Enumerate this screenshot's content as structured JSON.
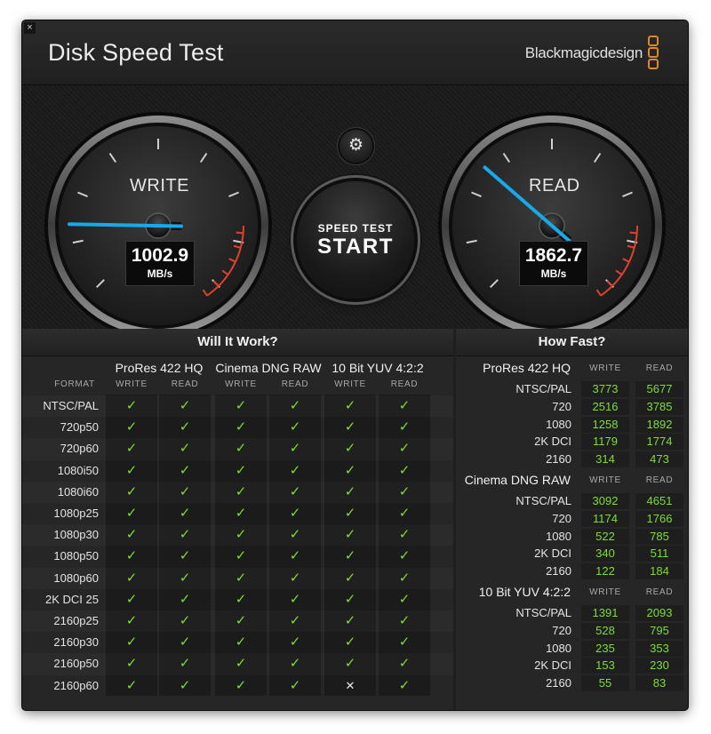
{
  "window": {
    "close_icon": "close-icon",
    "close_glyph": "×",
    "title": "Disk Speed Test",
    "brand": "Blackmagicdesign"
  },
  "gauges": {
    "write": {
      "label": "WRITE",
      "value": "1002.9",
      "unit": "MB/s"
    },
    "read": {
      "label": "READ",
      "value": "1862.7",
      "unit": "MB/s"
    }
  },
  "controls": {
    "settings_icon": "gear-icon",
    "settings_glyph": "⚙",
    "start_small": "SPEED TEST",
    "start_big": "START"
  },
  "will_it_work": {
    "title": "Will It Work?",
    "format_label": "FORMAT",
    "codecs": [
      "ProRes 422 HQ",
      "Cinema DNG RAW",
      "10 Bit YUV 4:2:2"
    ],
    "sub": [
      "WRITE",
      "READ"
    ],
    "check_glyph": "✓",
    "cross_glyph": "✕",
    "rows": [
      {
        "format": "NTSC/PAL",
        "results": [
          true,
          true,
          true,
          true,
          true,
          true
        ]
      },
      {
        "format": "720p50",
        "results": [
          true,
          true,
          true,
          true,
          true,
          true
        ]
      },
      {
        "format": "720p60",
        "results": [
          true,
          true,
          true,
          true,
          true,
          true
        ]
      },
      {
        "format": "1080i50",
        "results": [
          true,
          true,
          true,
          true,
          true,
          true
        ]
      },
      {
        "format": "1080i60",
        "results": [
          true,
          true,
          true,
          true,
          true,
          true
        ]
      },
      {
        "format": "1080p25",
        "results": [
          true,
          true,
          true,
          true,
          true,
          true
        ]
      },
      {
        "format": "1080p30",
        "results": [
          true,
          true,
          true,
          true,
          true,
          true
        ]
      },
      {
        "format": "1080p50",
        "results": [
          true,
          true,
          true,
          true,
          true,
          true
        ]
      },
      {
        "format": "1080p60",
        "results": [
          true,
          true,
          true,
          true,
          true,
          true
        ]
      },
      {
        "format": "2K DCI 25",
        "results": [
          true,
          true,
          true,
          true,
          true,
          true
        ]
      },
      {
        "format": "2160p25",
        "results": [
          true,
          true,
          true,
          true,
          true,
          true
        ]
      },
      {
        "format": "2160p30",
        "results": [
          true,
          true,
          true,
          true,
          true,
          true
        ]
      },
      {
        "format": "2160p50",
        "results": [
          true,
          true,
          true,
          true,
          true,
          true
        ]
      },
      {
        "format": "2160p60",
        "results": [
          true,
          true,
          true,
          true,
          false,
          true
        ]
      }
    ]
  },
  "how_fast": {
    "title": "How Fast?",
    "sub": [
      "WRITE",
      "READ"
    ],
    "groups": [
      {
        "name": "ProRes 422 HQ",
        "rows": [
          {
            "format": "NTSC/PAL",
            "write": "3773",
            "read": "5677"
          },
          {
            "format": "720",
            "write": "2516",
            "read": "3785"
          },
          {
            "format": "1080",
            "write": "1258",
            "read": "1892"
          },
          {
            "format": "2K DCI",
            "write": "1179",
            "read": "1774"
          },
          {
            "format": "2160",
            "write": "314",
            "read": "473"
          }
        ]
      },
      {
        "name": "Cinema DNG RAW",
        "rows": [
          {
            "format": "NTSC/PAL",
            "write": "3092",
            "read": "4651"
          },
          {
            "format": "720",
            "write": "1174",
            "read": "1766"
          },
          {
            "format": "1080",
            "write": "522",
            "read": "785"
          },
          {
            "format": "2K DCI",
            "write": "340",
            "read": "511"
          },
          {
            "format": "2160",
            "write": "122",
            "read": "184"
          }
        ]
      },
      {
        "name": "10 Bit YUV 4:2:2",
        "rows": [
          {
            "format": "NTSC/PAL",
            "write": "1391",
            "read": "2093"
          },
          {
            "format": "720",
            "write": "528",
            "read": "795"
          },
          {
            "format": "1080",
            "write": "235",
            "read": "353"
          },
          {
            "format": "2K DCI",
            "write": "153",
            "read": "230"
          },
          {
            "format": "2160",
            "write": "55",
            "read": "83"
          }
        ]
      }
    ]
  },
  "colors": {
    "accent_green": "#7fdc35",
    "needle_blue": "#19a8e8",
    "redline": "#e0412e",
    "brand_orange": "#d9892a"
  }
}
